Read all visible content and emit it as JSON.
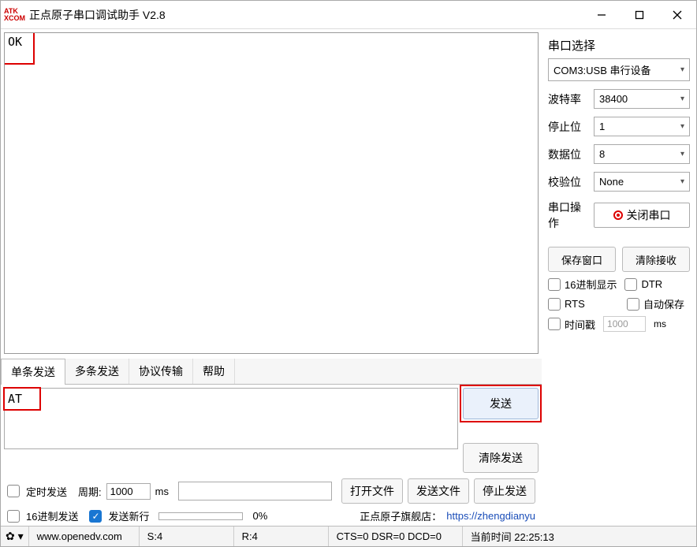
{
  "titlebar": {
    "title": "正点原子串口调试助手 V2.8",
    "logo": "ATK\nXCOM"
  },
  "rx": {
    "content": "OK"
  },
  "tabs": {
    "single": "单条发送",
    "multi": "多条发送",
    "proto": "协议传输",
    "help": "帮助"
  },
  "tx": {
    "content": "AT"
  },
  "buttons": {
    "send": "发送",
    "clearSend": "清除发送",
    "openFile": "打开文件",
    "sendFile": "发送文件",
    "stopSend": "停止发送",
    "saveWin": "保存窗口",
    "clearRecv": "清除接收",
    "closePort": "关闭串口"
  },
  "options": {
    "timedSend": "定时发送",
    "period": "周期:",
    "periodVal": "1000",
    "ms": "ms",
    "hexSend": "16进制发送",
    "sendNewline": "发送新行",
    "hexDisplay": "16进制显示",
    "dtr": "DTR",
    "rts": "RTS",
    "autoSave": "自动保存",
    "timestamp": "时间戳",
    "tsVal": "1000",
    "tsMs": "ms",
    "progressPct": "0%"
  },
  "sidebar": {
    "title": "串口选择",
    "port": "COM3:USB 串行设备",
    "baudLabel": "波特率",
    "baud": "38400",
    "stopLabel": "停止位",
    "stop": "1",
    "dataLabel": "数据位",
    "databits": "8",
    "parityLabel": "校验位",
    "parity": "None",
    "opLabel": "串口操作"
  },
  "footer": {
    "shopText": "正点原子旗舰店：",
    "shopUrl": "https://zhengdianyu",
    "url": "www.openedv.com",
    "s": "S:4",
    "r": "R:4",
    "ctsdsr": "CTS=0 DSR=0 DCD=0",
    "time": "当前时间 22:25:13"
  }
}
